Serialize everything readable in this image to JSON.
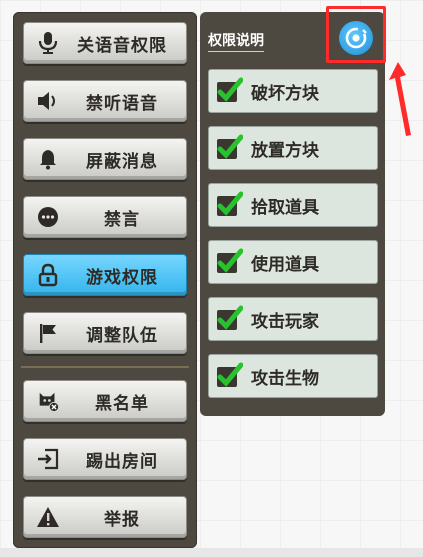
{
  "left_menu": {
    "items": [
      {
        "label": "关语音权限",
        "icon": "microphone-icon"
      },
      {
        "label": "禁听语音",
        "icon": "speaker-mute-icon"
      },
      {
        "label": "屏蔽消息",
        "icon": "bell-icon"
      },
      {
        "label": "禁言",
        "icon": "chat-bubble-icon"
      },
      {
        "label": "游戏权限",
        "icon": "lock-icon",
        "active": true
      },
      {
        "label": "调整队伍",
        "icon": "flag-icon"
      },
      {
        "label": "黑名单",
        "icon": "blocked-user-icon"
      },
      {
        "label": "踢出房间",
        "icon": "exit-room-icon"
      },
      {
        "label": "举报",
        "icon": "warning-icon"
      }
    ]
  },
  "permissions": {
    "title": "权限说明",
    "settings_icon": "settings-icon",
    "items": [
      {
        "label": "破坏方块",
        "checked": true
      },
      {
        "label": "放置方块",
        "checked": true
      },
      {
        "label": "拾取道具",
        "checked": true
      },
      {
        "label": "使用道具",
        "checked": true
      },
      {
        "label": "攻击玩家",
        "checked": true
      },
      {
        "label": "攻击生物",
        "checked": true
      }
    ]
  },
  "colors": {
    "panel": "#4d4840",
    "active_button": "#33b4ec",
    "checkbox_green": "#27c22d",
    "highlight": "#ff2a2a"
  }
}
